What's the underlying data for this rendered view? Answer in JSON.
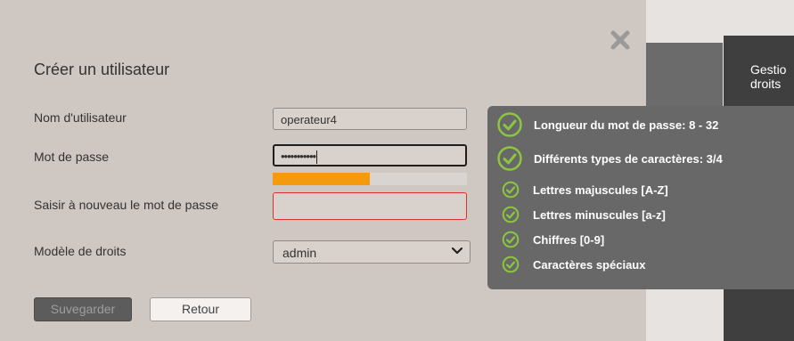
{
  "dialog": {
    "title": "Créer un utilisateur",
    "close_icon": "close-x-icon"
  },
  "form": {
    "username": {
      "label": "Nom d'utilisateur",
      "value": "operateur4"
    },
    "password": {
      "label": "Mot de passe",
      "value": "•••••••••••",
      "strength_percent": 50,
      "strength_color": "#f39a0e"
    },
    "password_confirm": {
      "label": "Saisir à nouveau le mot de passe",
      "value": "",
      "error_border": "#e0302b"
    },
    "rights_model": {
      "label": "Modèle de droits",
      "selected": "admin"
    }
  },
  "buttons": {
    "save": "Suvegarder",
    "back": "Retour"
  },
  "password_requirements": [
    {
      "text": "Longueur du mot de passe: 8 - 32",
      "met": true
    },
    {
      "text": "Différents types de caractères: 3/4",
      "met": true
    },
    {
      "text": "Lettres majuscules [A-Z]",
      "met": true
    },
    {
      "text": "Lettres minuscules [a-z]",
      "met": true
    },
    {
      "text": "Chiffres [0-9]",
      "met": true
    },
    {
      "text": "Caractères spéciaux",
      "met": true
    }
  ],
  "background_panel": {
    "label_line1": "Gestio",
    "label_line2": "droits"
  },
  "colors": {
    "check_green": "#8cc63f",
    "tooltip_bg": "#686868"
  }
}
